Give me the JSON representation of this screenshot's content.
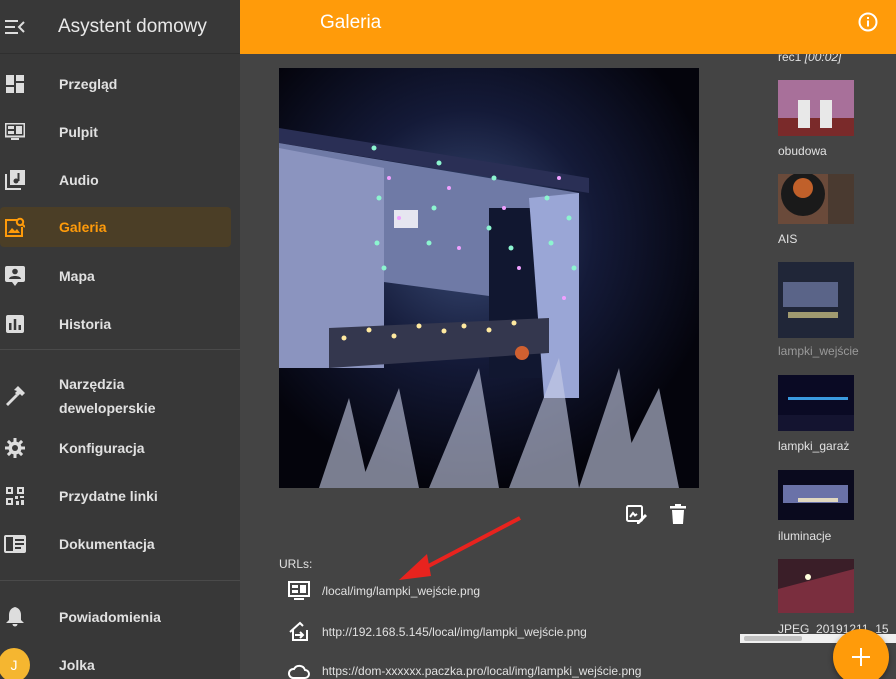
{
  "app": {
    "title": "Asystent domowy"
  },
  "header": {
    "title": "Galeria"
  },
  "sidebar": {
    "items": [
      {
        "label": "Przegląd",
        "icon": "dashboard-icon"
      },
      {
        "label": "Pulpit",
        "icon": "monitor-dashboard-icon"
      },
      {
        "label": "Audio",
        "icon": "music-library-icon"
      },
      {
        "label": "Galeria",
        "icon": "image-search-icon",
        "active": true
      },
      {
        "label": "Mapa",
        "icon": "account-box-icon"
      },
      {
        "label": "Historia",
        "icon": "chart-box-icon"
      }
    ],
    "tools": [
      {
        "label": "Narzędzia",
        "label2": "deweloperskie",
        "icon": "hammer-icon"
      },
      {
        "label": "Konfiguracja",
        "icon": "gear-icon"
      },
      {
        "label": "Przydatne linki",
        "icon": "qrcode-icon"
      },
      {
        "label": "Dokumentacja",
        "icon": "book-icon"
      }
    ],
    "notifications": {
      "label": "Powiadomienia",
      "icon": "bell-icon"
    },
    "user": {
      "initial": "J",
      "name": "Jolka"
    }
  },
  "main": {
    "urls_label": "URLs:",
    "urls": [
      {
        "text": "/local/img/lampki_wejście.png",
        "icon": "monitor-icon"
      },
      {
        "text": "http://192.168.5.145/local/img/lampki_wejście.png",
        "icon": "login-icon"
      },
      {
        "text": "https://dom-xxxxxx.paczka.pro/local/img/lampki_wejście.png",
        "icon": "cloud-icon"
      }
    ]
  },
  "gallery": {
    "top_label": "rec1",
    "top_label_time": "[00:02]",
    "items": [
      {
        "label": "obudowa"
      },
      {
        "label": "AIS"
      },
      {
        "label": "lampki_wejście",
        "selected": true
      },
      {
        "label": "lampki_garaż"
      },
      {
        "label": "iluminacje"
      },
      {
        "label": "JPEG_20191211_15"
      }
    ]
  },
  "colors": {
    "accent": "#ff9b0a",
    "sidebar": "#383838",
    "main": "#444444"
  }
}
